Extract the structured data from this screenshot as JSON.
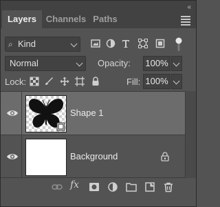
{
  "tabs": [
    {
      "label": "Layers",
      "active": true
    },
    {
      "label": "Channels",
      "active": false
    },
    {
      "label": "Paths",
      "active": false
    }
  ],
  "collapse_glyph": "«",
  "filter": {
    "kind_label": "Kind",
    "icons": [
      "pixel-filter-icon",
      "adjustment-filter-icon",
      "type-filter-icon",
      "shape-filter-icon",
      "smart-object-filter-icon",
      "filter-toggle-icon"
    ]
  },
  "blend": {
    "mode": "Normal",
    "opacity_label": "Opacity:",
    "opacity_value": "100%"
  },
  "lock": {
    "label": "Lock:",
    "icons": [
      "lock-transparent-pixels-icon",
      "lock-image-pixels-icon",
      "lock-position-icon",
      "lock-artboard-icon",
      "lock-all-icon"
    ],
    "fill_label": "Fill:",
    "fill_value": "100%"
  },
  "layers": [
    {
      "name": "Shape 1",
      "selected": true,
      "visible": true,
      "thumbnail": "butterfly-shape",
      "locked": false
    },
    {
      "name": "Background",
      "selected": false,
      "visible": true,
      "thumbnail": "white-fill",
      "locked": true
    }
  ],
  "bottom_toolbar": {
    "fx_label": "fx",
    "icons": [
      "link-layers-icon",
      "layer-style-icon",
      "add-mask-icon",
      "new-fill-adjustment-icon",
      "new-group-icon",
      "new-layer-icon",
      "delete-layer-icon"
    ]
  },
  "colors": {
    "panel_bg": "#535353",
    "tab_strip_bg": "#424242",
    "selected_row_bg": "#6c6c6c",
    "field_bg": "#424242",
    "text": "#d6d6d6"
  }
}
